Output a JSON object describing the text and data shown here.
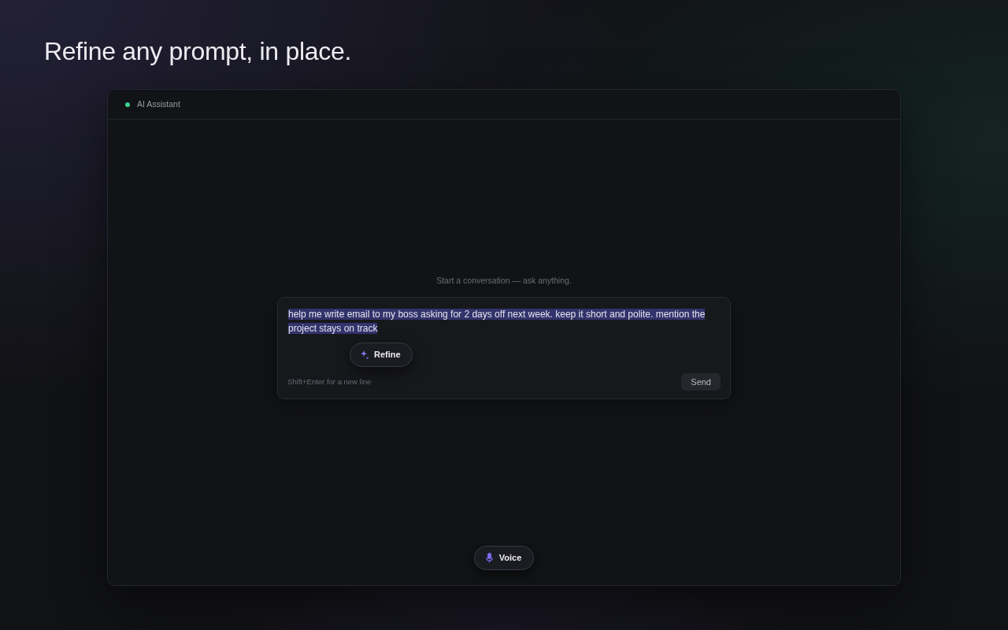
{
  "headline": "Refine any prompt, in place.",
  "panel": {
    "title": "AI Assistant",
    "empty_state": "Start a conversation — ask anything.",
    "composer": {
      "value": "help me write email to my boss asking for 2 days off next week. keep it short and polite. mention the project stays on track",
      "selected": true,
      "refine_button": "Refine",
      "hint": "Shift+Enter for a new line",
      "send_button": "Send"
    },
    "voice_button": "Voice"
  }
}
